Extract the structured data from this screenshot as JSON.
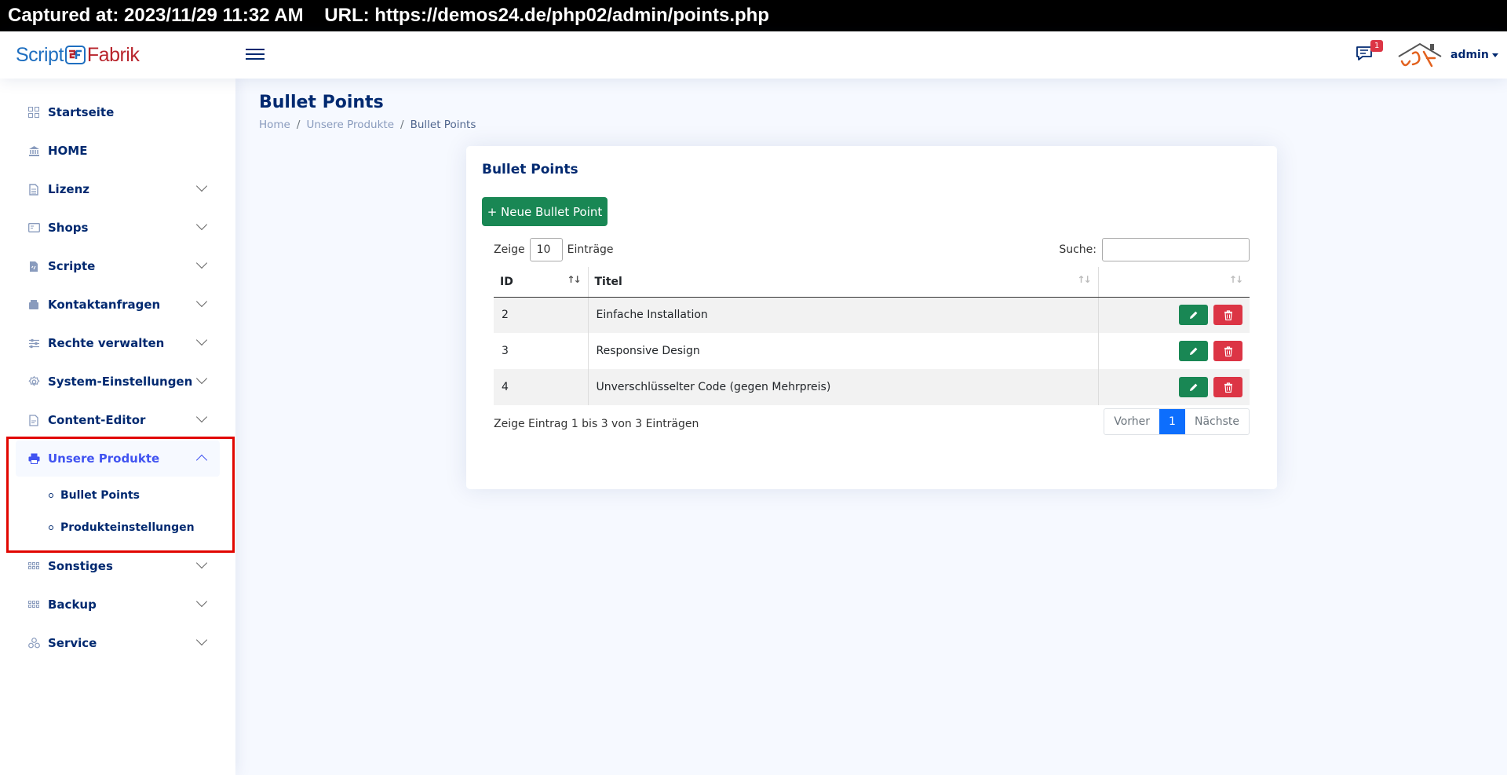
{
  "capture": {
    "text": "Captured at: 2023/11/29 11:32 AM    URL: https://demos24.de/php02/admin/points.php"
  },
  "header": {
    "logo_left": "Script",
    "logo_right": "Fabrik",
    "messages_badge": "1",
    "user_name": "admin"
  },
  "sidebar": {
    "items": [
      {
        "label": "Startseite",
        "icon": "grid-icon"
      },
      {
        "label": "HOME",
        "icon": "bank-icon"
      },
      {
        "label": "Lizenz",
        "icon": "document-icon"
      },
      {
        "label": "Shops",
        "icon": "card-icon"
      },
      {
        "label": "Scripte",
        "icon": "script-file-icon"
      },
      {
        "label": "Kontaktanfragen",
        "icon": "inbox-icon"
      },
      {
        "label": "Rechte verwalten",
        "icon": "sliders-icon"
      },
      {
        "label": "System-Einstellungen",
        "icon": "gear-icon"
      },
      {
        "label": "Content-Editor",
        "icon": "file-text-icon"
      },
      {
        "label": "Unsere Produkte",
        "icon": "printer-icon"
      },
      {
        "label": "Sonstiges",
        "icon": "dots-grid-icon"
      },
      {
        "label": "Backup",
        "icon": "dots-grid-icon"
      },
      {
        "label": "Service",
        "icon": "hexagon-icon"
      }
    ],
    "sub_items": [
      {
        "label": "Bullet Points"
      },
      {
        "label": "Produkteinstellungen"
      }
    ]
  },
  "page": {
    "title": "Bullet Points",
    "breadcrumb": [
      "Home",
      "Unsere Produkte",
      "Bullet Points"
    ]
  },
  "card": {
    "title": "Bullet Points",
    "new_button": "+ Neue Bullet Point",
    "length_prefix": "Zeige",
    "length_value": "10",
    "length_suffix": "Einträge",
    "search_label": "Suche:",
    "search_value": "",
    "columns": [
      "ID",
      "Titel",
      ""
    ],
    "rows": [
      {
        "id": "2",
        "title": "Einfache Installation"
      },
      {
        "id": "3",
        "title": "Responsive Design"
      },
      {
        "id": "4",
        "title": "Unverschlüsselter Code (gegen Mehrpreis)"
      }
    ],
    "info": "Zeige Eintrag 1 bis 3 von 3 Einträgen",
    "pager": {
      "prev": "Vorher",
      "current": "1",
      "next": "Nächste"
    }
  },
  "colors": {
    "primary_text": "#012970",
    "active": "#4154f1",
    "success": "#198754",
    "danger": "#dc3545",
    "page_current": "#0d6efd",
    "highlight_box": "#e10600"
  }
}
